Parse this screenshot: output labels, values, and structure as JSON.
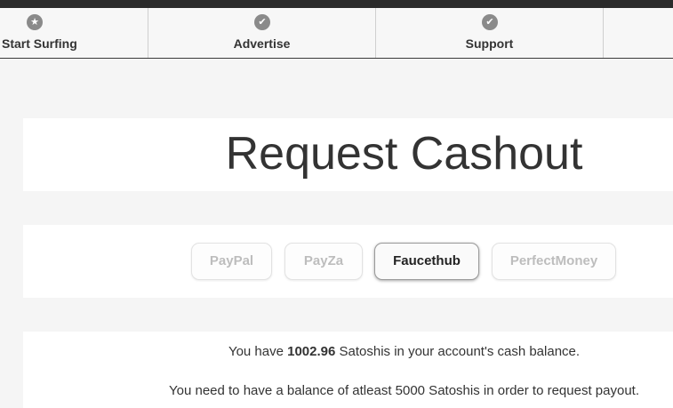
{
  "nav": {
    "items": [
      {
        "label": "Start Surfing",
        "icon": "star-icon"
      },
      {
        "label": "Advertise",
        "icon": "check-icon"
      },
      {
        "label": "Support",
        "icon": "check-icon"
      }
    ]
  },
  "page": {
    "title": "Request Cashout"
  },
  "methods": {
    "items": [
      {
        "label": "PayPal",
        "active": false
      },
      {
        "label": "PayZa",
        "active": false
      },
      {
        "label": "Faucethub",
        "active": true
      },
      {
        "label": "PerfectMoney",
        "active": false
      }
    ]
  },
  "info": {
    "balance_prefix": "You have ",
    "balance_value": "1002.96",
    "balance_suffix": " Satoshis in your account's cash balance.",
    "requirement": "You need to have a balance of atleast 5000 Satoshis in order to request payout."
  },
  "colors": {
    "topbar": "#2b2b2b",
    "icon": "#8a8a8a",
    "active_text": "#222222",
    "inactive_text": "#bdbdbd"
  }
}
